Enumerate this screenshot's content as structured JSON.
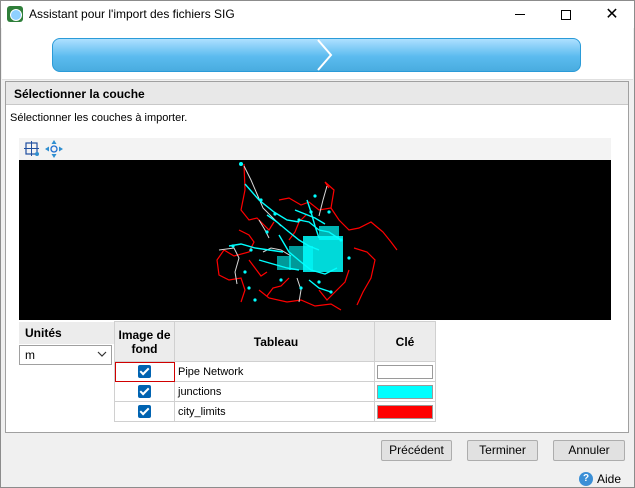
{
  "window": {
    "title": "Assistant pour l'import des fichiers SIG",
    "icon": "gis-app-icon",
    "controls": {
      "minimize": "minimize-icon",
      "maximize": "maximize-icon",
      "close": "✕"
    }
  },
  "wizard": {
    "progress_color": "#5bbbef"
  },
  "panel": {
    "header": "Sélectionner la couche",
    "instruction": "Sélectionner les couches à importer."
  },
  "map_toolbar": {
    "tools": [
      "zoom-extent-icon",
      "pan-icon"
    ]
  },
  "units": {
    "label": "Unités",
    "value": "m"
  },
  "layers_table": {
    "headers": {
      "background": "Image de fond",
      "table": "Tableau",
      "key": "Clé"
    },
    "rows": [
      {
        "checked": true,
        "name": "Pipe Network",
        "key_color": "#ffffff"
      },
      {
        "checked": true,
        "name": "junctions",
        "key_color": "#00ffff"
      },
      {
        "checked": true,
        "name": "city_limits",
        "key_color": "#ff0000"
      }
    ]
  },
  "buttons": {
    "previous": "Précédent",
    "finish": "Terminer",
    "cancel": "Annuler"
  },
  "help": {
    "label": "Aide"
  },
  "colors": {
    "map_background": "#000000",
    "network": "#00ffff",
    "limits": "#ff0000",
    "pipes": "#ffffff"
  }
}
